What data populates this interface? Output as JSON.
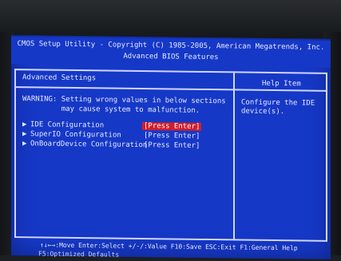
{
  "header": {
    "title_line1": "CMOS Setup Utility - Copyright (C) 1985-2005, American Megatrends, Inc.",
    "title_line2": "Advanced BIOS Features"
  },
  "panel": {
    "title": "Advanced Settings",
    "warning_line1": "WARNING: Setting wrong values in below sections",
    "warning_line2": "         may cause system to malfunction."
  },
  "menu": {
    "items": [
      {
        "arrow": "▶",
        "label": "IDE Configuration",
        "value": "[Press Enter]",
        "selected": true
      },
      {
        "arrow": "▶",
        "label": "SuperIO Configuration",
        "value": "[Press Enter]",
        "selected": false
      },
      {
        "arrow": "▶",
        "label": "OnBoardDevice Configuration",
        "value": "[Press Enter]",
        "selected": false
      }
    ]
  },
  "help": {
    "title": "Help Item",
    "line1": "Configure the IDE",
    "line2": "device(s)."
  },
  "footer": {
    "line1": "↑↓←→:Move  Enter:Select  +/-/:Value  F10:Save  ESC:Exit  F1:General Help",
    "line2": "F5:Optimized Defaults"
  },
  "colors": {
    "screen_blue": "#1638c7",
    "selection_red": "#d21d2b",
    "text": "#e6e9ff"
  }
}
